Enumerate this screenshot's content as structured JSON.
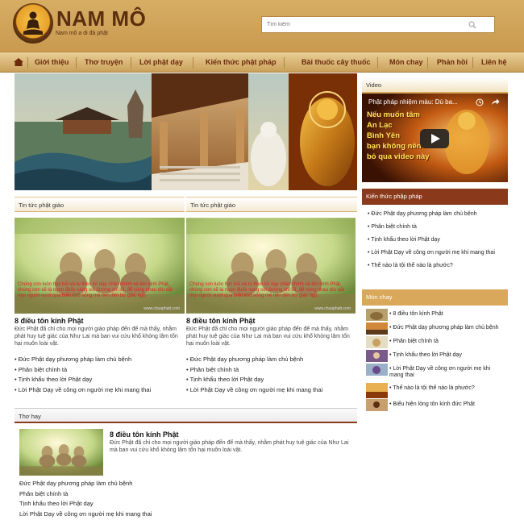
{
  "header": {
    "site_title": "NAM MÔ",
    "site_subtitle": "Nam mô a di đà phật",
    "search_placeholder": "Tìm kiếm"
  },
  "nav": {
    "items": [
      "Giới thiệu",
      "Thơ truyện",
      "Lời phật dạy",
      "Kiến thức phật pháp",
      "Bài thuốc cây thuốc",
      "Món chay",
      "Phản hồi",
      "Liên hệ"
    ]
  },
  "news": {
    "col1": {
      "heading": "Tin tức phật giáo",
      "thumb_caption": "Chúng con luôn học hỏi và tu theo lời dạy chân chính và tôn kính Phật, chúng con sẽ là ngọn đuốc sáng soi đường chỉ lối, để cùng nhau dìu dắt mọi người vượt qua biển khổ sống mê tiến đến bờ giác ngộ.",
      "thumb_site": "www.chuaphatt.com",
      "title": "8 điều tôn kính Phật",
      "desc": "Đức Phật đã chỉ cho mọi người giáo pháp đến để mà thấy, nhằm phát huy tuệ giác của Như Lai mà ban vui cứu khổ khỏng lâm tổn hại muôn loài vật.",
      "links": [
        "Đức Phật dạy phương pháp làm chủ bệnh",
        "Phân biệt chính tà",
        "Tịnh khẩu theo lời Phật dạy",
        "Lời Phật Dạy về công ơn người mẹ khi mang thai"
      ]
    },
    "col2": {
      "heading": "Tin tức phật giáo",
      "thumb_caption": "Chúng con luôn học hỏi và tu theo lời dạy chân chính và tôn kính Phật, chúng con sẽ là ngọn đuốc sáng soi đường chỉ lối, để cùng nhau dìu dắt mọi người vượt qua biển khổ sống mê tiến đến bờ giác ngộ.",
      "thumb_site": "www.chuaphatt.com",
      "title": "8 điều tôn kính Phật",
      "desc": "Đức Phật đã chỉ cho mọi người giáo pháp đến để mà thấy, nhằm phát huy tuệ giác của Như Lai mà ban vui cứu khổ khỏng lâm tổn hại muôn loài vật.",
      "links": [
        "Đức Phật dạy phương pháp làm chủ bệnh",
        "Phân biệt chính tà",
        "Tịnh khẩu theo lời Phật dạy",
        "Lời Phật Dạy về công ơn người mẹ khi mang thai"
      ]
    }
  },
  "poems": {
    "heading": "Thơ hay",
    "title": "8 điều tôn kính Phật",
    "desc": "Đức Phật đã chỉ cho mọi người giáo pháp đến để mà thấy, nhằm phát huy tuệ giác của Như Lai mà ban vui cứu khổ khỏng lâm tổn hại muôn loài vật.",
    "links": [
      "Đức Phật dạy phương pháp làm chủ bệnh",
      "Phân biệt chính tà",
      "Tịnh khẩu theo lời Phật dạy",
      "Lời Phật Dạy về công ơn người mẹ khi mang thai"
    ]
  },
  "sidebar": {
    "video": {
      "heading": "Video",
      "title": "Phật pháp nhiệm màu: Dù ba...",
      "overlay_lines": [
        "Nếu muốn tâm",
        "An Lạc",
        "Bình Yên",
        "bạn không nên",
        "bỏ qua video này"
      ]
    },
    "knowledge": {
      "heading": "Kiến thức phập pháp",
      "items": [
        "Đức Phật dạy phương pháp làm chủ bệnh",
        "Phân biệt chính tà",
        "Tịnh khẩu theo lời Phật dạy",
        "Lời Phật Dạy về công ơn người mẹ khi mang thai",
        "Thế nào là tội thế nào là phước?"
      ]
    },
    "food": {
      "heading": "Món chay",
      "items": [
        "8 điều tôn kính Phật",
        "Đức Phật dạy phương pháp làm chủ bệnh",
        "Phân biệt chính tà",
        "Tịnh khẩu theo lời Phật dạy",
        "Lời Phật Dạy về công ơn người mẹ khi mang thai",
        "Thế nào là tội thế nào là phước?",
        "Biểu hiện lòng tôn kính đức Phật"
      ]
    }
  },
  "colors": {
    "header_bg": "#d7ad64",
    "nav_text": "#6b2a0c",
    "sidebar_head_dark": "#8a3a1a",
    "sidebar_head_gold": "#d9a85a"
  }
}
